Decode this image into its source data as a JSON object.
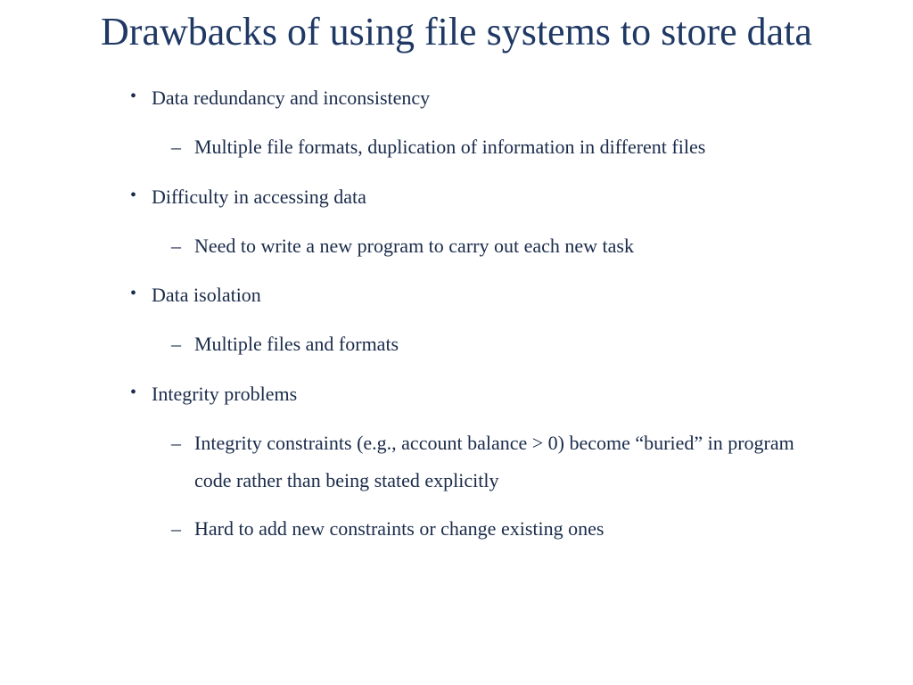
{
  "title": "Drawbacks of using file systems to store data",
  "bullets": [
    {
      "text": "Data redundancy and inconsistency",
      "sub": [
        "Multiple file formats, duplication of information in different files"
      ]
    },
    {
      "text": "Difficulty in accessing data",
      "sub": [
        "Need to write a new program to carry out each new task"
      ]
    },
    {
      "text": "Data isolation",
      "sub": [
        "Multiple files and formats"
      ]
    },
    {
      "text": "Integrity problems",
      "sub": [
        "Integrity constraints  (e.g., account balance > 0) become “buried” in program code rather than being stated explicitly",
        "Hard to add new constraints or change existing ones"
      ]
    }
  ]
}
